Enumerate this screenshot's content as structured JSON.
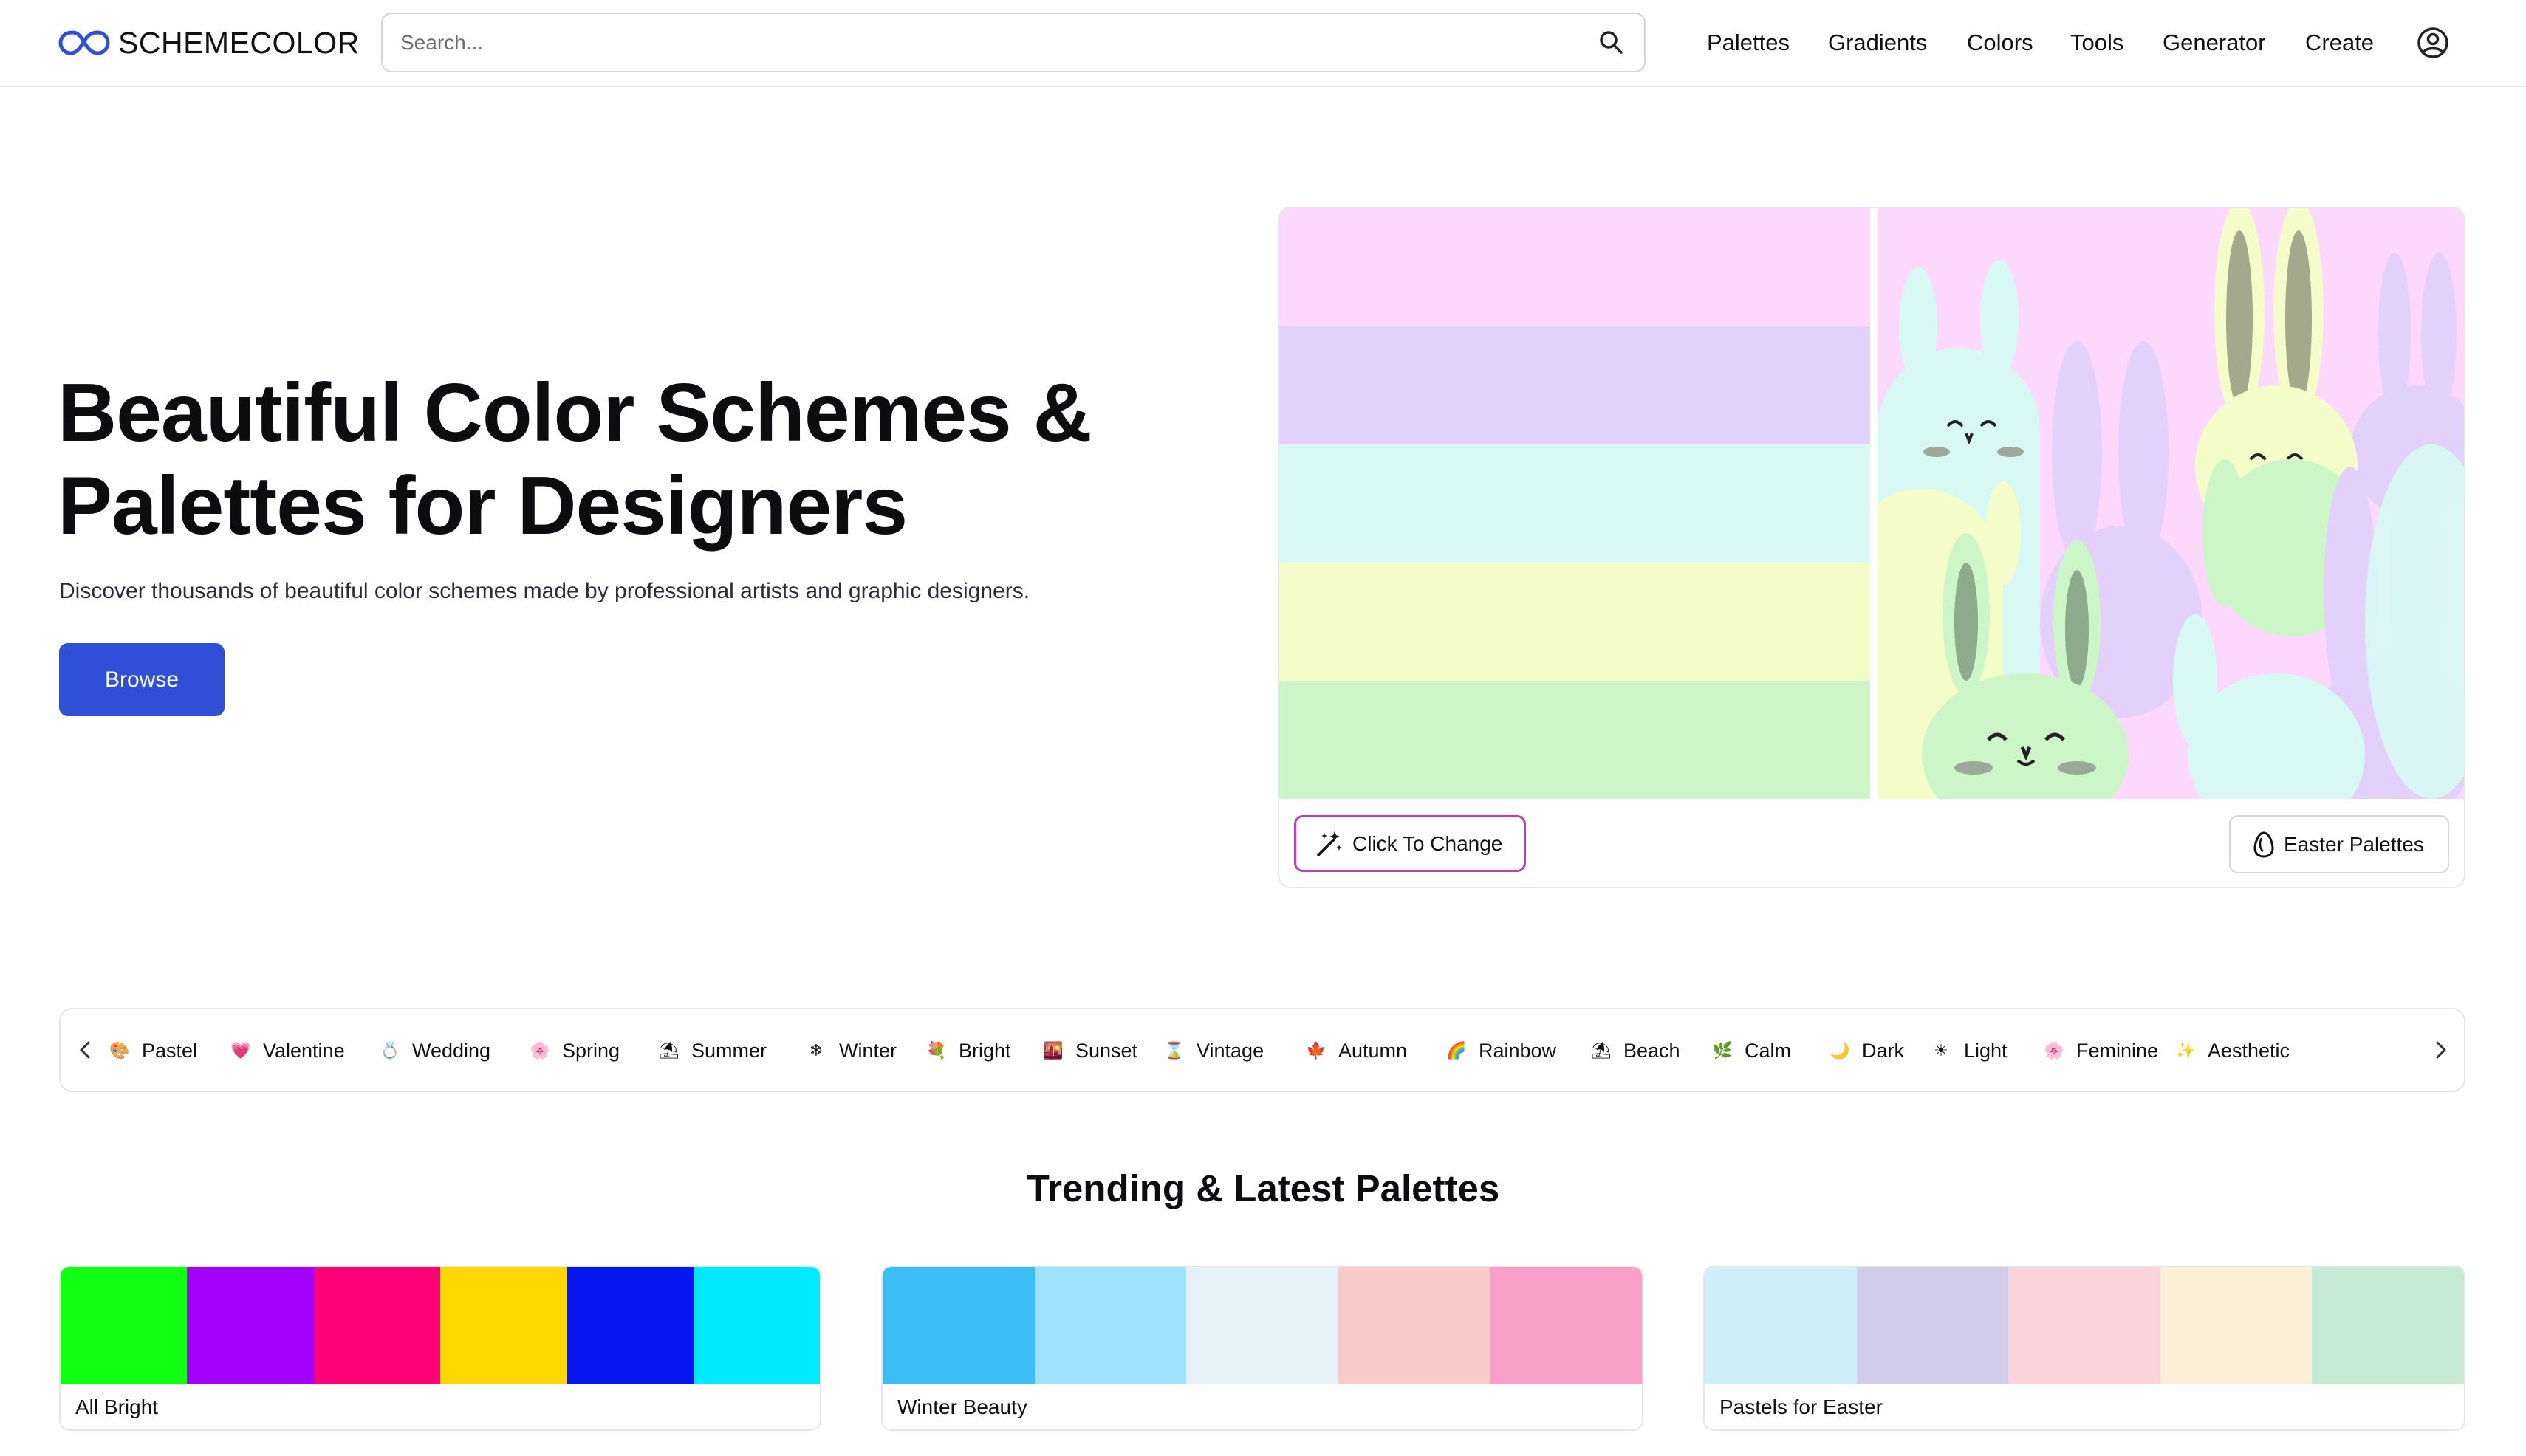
{
  "header": {
    "logo_text": "SCHEMECOLOR",
    "search_placeholder": "Search...",
    "nav": [
      "Palettes",
      "Gradients",
      "Colors",
      "Tools",
      "Generator",
      "Create"
    ]
  },
  "hero": {
    "title_line1": "Beautiful Color Schemes &",
    "title_line2": "Palettes for Designers",
    "subtitle": "Discover thousands of beautiful color schemes made by professional artists and graphic designers.",
    "browse_label": "Browse"
  },
  "feature": {
    "stripe_colors": [
      "#FDD8FD",
      "#E3D1FB",
      "#D8F8F4",
      "#F4FDCA",
      "#CCF6C8"
    ],
    "change_label": "Click To Change",
    "easter_label": "Easter Palettes"
  },
  "categories": [
    {
      "emoji": "🎨",
      "label": "Pastel"
    },
    {
      "emoji": "💗",
      "label": "Valentine"
    },
    {
      "emoji": "💍",
      "label": "Wedding"
    },
    {
      "emoji": "🌸",
      "label": "Spring"
    },
    {
      "emoji": "⛱",
      "label": "Summer"
    },
    {
      "emoji": "❄",
      "label": "Winter"
    },
    {
      "emoji": "💐",
      "label": "Bright"
    },
    {
      "emoji": "🌇",
      "label": "Sunset"
    },
    {
      "emoji": "⌛",
      "label": "Vintage"
    },
    {
      "emoji": "🍁",
      "label": "Autumn"
    },
    {
      "emoji": "🌈",
      "label": "Rainbow"
    },
    {
      "emoji": "⛱",
      "label": "Beach"
    },
    {
      "emoji": "🌿",
      "label": "Calm"
    },
    {
      "emoji": "🌙",
      "label": "Dark"
    },
    {
      "emoji": "☀",
      "label": "Light"
    },
    {
      "emoji": "🌸",
      "label": "Feminine"
    },
    {
      "emoji": "✨",
      "label": "Aesthetic"
    }
  ],
  "trending": {
    "title": "Trending & Latest Palettes",
    "palettes": [
      {
        "name": "All Bright",
        "colors": [
          "#12FF12",
          "#A200F8",
          "#FF0079",
          "#FFD700",
          "#0516EF",
          "#00EAFE"
        ]
      },
      {
        "name": "Winter Beauty",
        "colors": [
          "#3ABEF5",
          "#9FE2FC",
          "#E5F1F8",
          "#F9CBC8",
          "#F9A0C9"
        ]
      },
      {
        "name": "Pastels for Easter",
        "colors": [
          "#CFF0F8",
          "#D0CCEA",
          "#FCD3DA",
          "#FCEFD8",
          "#C6EAD3"
        ]
      }
    ]
  }
}
